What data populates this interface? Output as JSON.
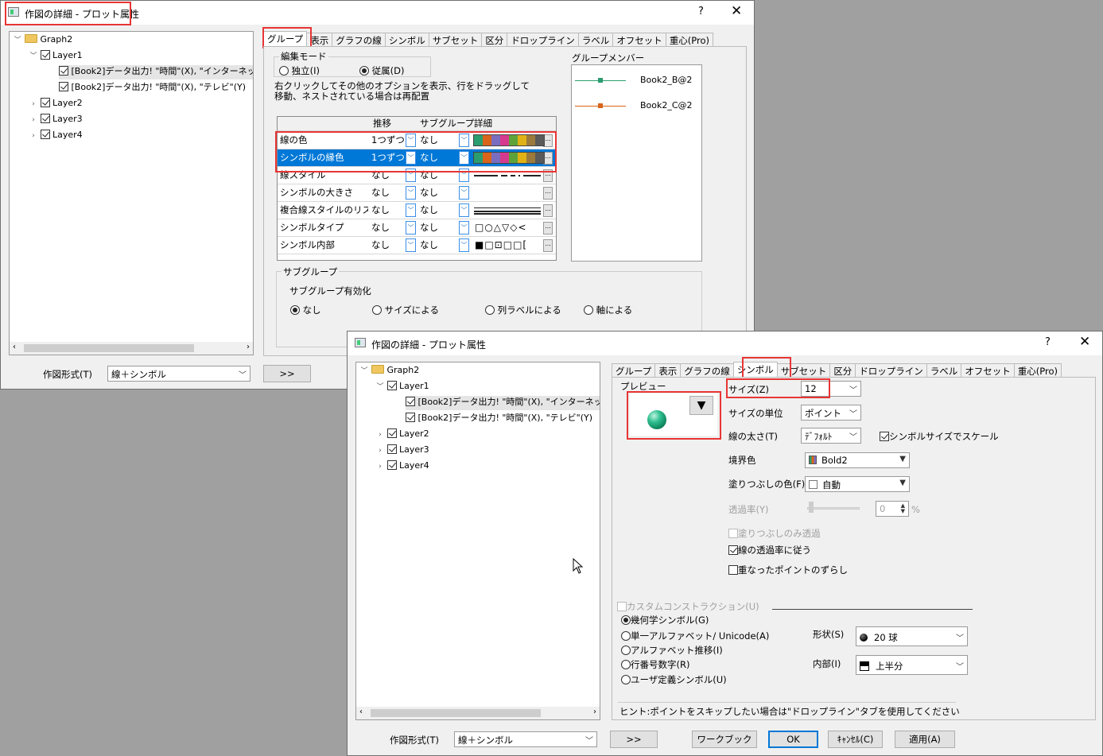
{
  "win1": {
    "title": "作図の詳細 - プロット属性",
    "help": "?",
    "close": "✕",
    "tree": {
      "graph": "Graph2",
      "layer1": "Layer1",
      "plot1": "[Book2]データ出力! \"時間\"(X), \"インターネッ",
      "plot2": "[Book2]データ出力! \"時間\"(X), \"テレビ\"(Y)",
      "layer2": "Layer2",
      "layer3": "Layer3",
      "layer4": "Layer4"
    },
    "tabs": [
      "グループ",
      "表示",
      "グラフの線",
      "シンボル",
      "サブセット",
      "区分",
      "ドロップライン",
      "ラベル",
      "オフセット",
      "重心(Pro)"
    ],
    "edit_mode": {
      "title": "編集モード",
      "independent": "独立(I)",
      "dependent": "従属(D)"
    },
    "instructions": "右クリックしてその他のオプションを表示、行をドラッグして移動、ネストされている場合は再配置",
    "grid_headers": [
      "",
      "推移",
      "サブグループ",
      "詳細"
    ],
    "grid_rows": [
      {
        "name": "線の色",
        "inc": "1つずつ",
        "sub": "なし"
      },
      {
        "name": "シンボルの縁色",
        "inc": "1つずつ",
        "sub": "なし"
      },
      {
        "name": "線スタイル",
        "inc": "なし",
        "sub": "なし"
      },
      {
        "name": "シンボルの大きさ",
        "inc": "なし",
        "sub": "なし"
      },
      {
        "name": "複合線スタイルのリスト",
        "inc": "なし",
        "sub": "なし"
      },
      {
        "name": "シンボルタイプ",
        "inc": "なし",
        "sub": "なし"
      },
      {
        "name": "シンボル内部",
        "inc": "なし",
        "sub": "なし"
      }
    ],
    "symbol_types_glyphs": "□○△▽◇<",
    "symbol_interior_glyphs": "■□⊡□□[",
    "members_title": "グループメンバー",
    "members": [
      {
        "name": "Book2_B@2",
        "color": "#2a9d6e"
      },
      {
        "name": "Book2_C@2",
        "color": "#d9641a"
      }
    ],
    "subgroup": {
      "title": "サブグループ",
      "enable": "サブグループ有効化",
      "options": [
        "なし",
        "サイズによる",
        "列ラベルによる",
        "軸による"
      ]
    },
    "plot_type_label": "作図形式(T)",
    "plot_type_value": "線＋シンボル",
    "more_button": ">>",
    "palette": [
      "#2a9d6e",
      "#d9641a",
      "#7a6dbf",
      "#d63a8e",
      "#5ea33a",
      "#e0b216",
      "#9c7a3c",
      "#5a5a5a"
    ]
  },
  "win2": {
    "title": "作図の詳細 - プロット属性",
    "help": "?",
    "close": "✕",
    "tree": {
      "graph": "Graph2",
      "layer1": "Layer1",
      "plot1": "[Book2]データ出力! \"時間\"(X), \"インターネッ",
      "plot2": "[Book2]データ出力! \"時間\"(X), \"テレビ\"(Y)",
      "layer2": "Layer2",
      "layer3": "Layer3",
      "layer4": "Layer4"
    },
    "tabs": [
      "グループ",
      "表示",
      "グラフの線",
      "シンボル",
      "サブセット",
      "区分",
      "ドロップライン",
      "ラベル",
      "オフセット",
      "重心(Pro)"
    ],
    "preview_label": "プレビュー",
    "preview_arrow": "▼",
    "size_label": "サイズ(Z)",
    "size_value": "12",
    "size_unit_label": "サイズの単位",
    "size_unit_value": "ポイント",
    "line_width_label": "線の太さ(T)",
    "line_width_value": "ﾃﾞﾌｫﾙﾄ",
    "scale_with_symbol": "シンボルサイズでスケール",
    "edge_color_label": "境界色",
    "edge_color_value": "Bold2",
    "fill_color_label": "塗りつぶしの色(F)",
    "fill_color_value": "自動",
    "transparency_label": "透過率(Y)",
    "transparency_value": "0",
    "transparency_unit": "%",
    "fill_only": "塗りつぶしのみ透過",
    "follow_line": "線の透過率に従う",
    "offset_points": "重なったポイントのずらし",
    "custom_construction": "カスタムコンストラクション(U)",
    "construction_options": [
      "幾何学シンボル(G)",
      "単一アルファベット/ Unicode(A)",
      "アルファベット推移(I)",
      "行番号数字(R)",
      "ユーザ定義シンボル(U)"
    ],
    "shape_label": "形状(S)",
    "shape_value": "20 球",
    "interior_label": "内部(I)",
    "interior_value": "上半分",
    "hint": "ヒント:ポイントをスキップしたい場合は\"ドロップライン\"タブを使用してください",
    "plot_type_label": "作図形式(T)",
    "plot_type_value": "線＋シンボル",
    "buttons": {
      "more": ">>",
      "workbook": "ワークブック",
      "ok": "OK",
      "cancel": "ｷｬﾝｾﾙ(C)",
      "apply": "適用(A)"
    }
  }
}
